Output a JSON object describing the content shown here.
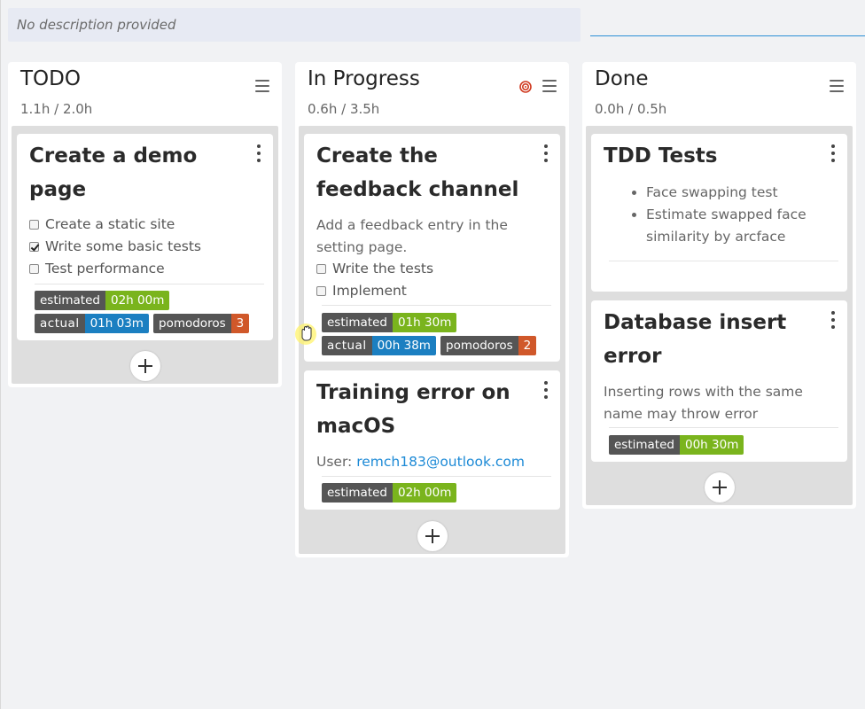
{
  "board": {
    "description_placeholder": "No description provided"
  },
  "columns": [
    {
      "title": "TODO",
      "hours": "1.1h / 2.0h",
      "cards": [
        {
          "title_line1": "Create a demo",
          "title_line2": "page",
          "checklist": [
            {
              "label": "Create a static site",
              "checked": false
            },
            {
              "label": "Write some basic tests",
              "checked": true
            },
            {
              "label": "Test performance",
              "checked": false
            }
          ],
          "badges": {
            "estimated_key": "estimated",
            "estimated_val": "02h 00m",
            "actual_key": "actual",
            "actual_val": "01h 03m",
            "pomodoros_key": "pomodoros",
            "pomodoros_val": "3"
          }
        }
      ]
    },
    {
      "title": "In Progress",
      "hours": "0.6h / 3.5h",
      "cards": [
        {
          "title_line1": "Create the",
          "title_line2": "feedback channel",
          "desc_line1": "Add a feedback entry in the",
          "desc_line2": "setting page.",
          "checklist": [
            {
              "label": "Write the tests",
              "checked": false
            },
            {
              "label": "Implement",
              "checked": false
            }
          ],
          "badges": {
            "estimated_key": "estimated",
            "estimated_val": "01h 30m",
            "actual_key": "actual",
            "actual_val": "00h 38m",
            "pomodoros_key": "pomodoros",
            "pomodoros_val": "2"
          }
        },
        {
          "title_line1": "Training error on",
          "title_line2": "macOS",
          "user_label": "User: ",
          "user_email": "remch183@outlook.com",
          "badges": {
            "estimated_key": "estimated",
            "estimated_val": "02h 00m"
          }
        }
      ]
    },
    {
      "title": "Done",
      "hours": "0.0h / 0.5h",
      "cards": [
        {
          "title_line1": "TDD Tests",
          "bullets": [
            "Face swapping test",
            "Estimate swapped face",
            "similarity by arcface"
          ]
        },
        {
          "title_line1": "Database insert",
          "title_line2": "error",
          "desc_line1": "Inserting rows with the same",
          "desc_line2": "name may throw error",
          "badges": {
            "estimated_key": "estimated",
            "estimated_val": "00h 30m"
          }
        }
      ]
    }
  ],
  "colors": {
    "estimated": "#7ab41d",
    "actual": "#1b7fc1",
    "pomodoros": "#d0582a",
    "link": "#1d8ad6"
  }
}
